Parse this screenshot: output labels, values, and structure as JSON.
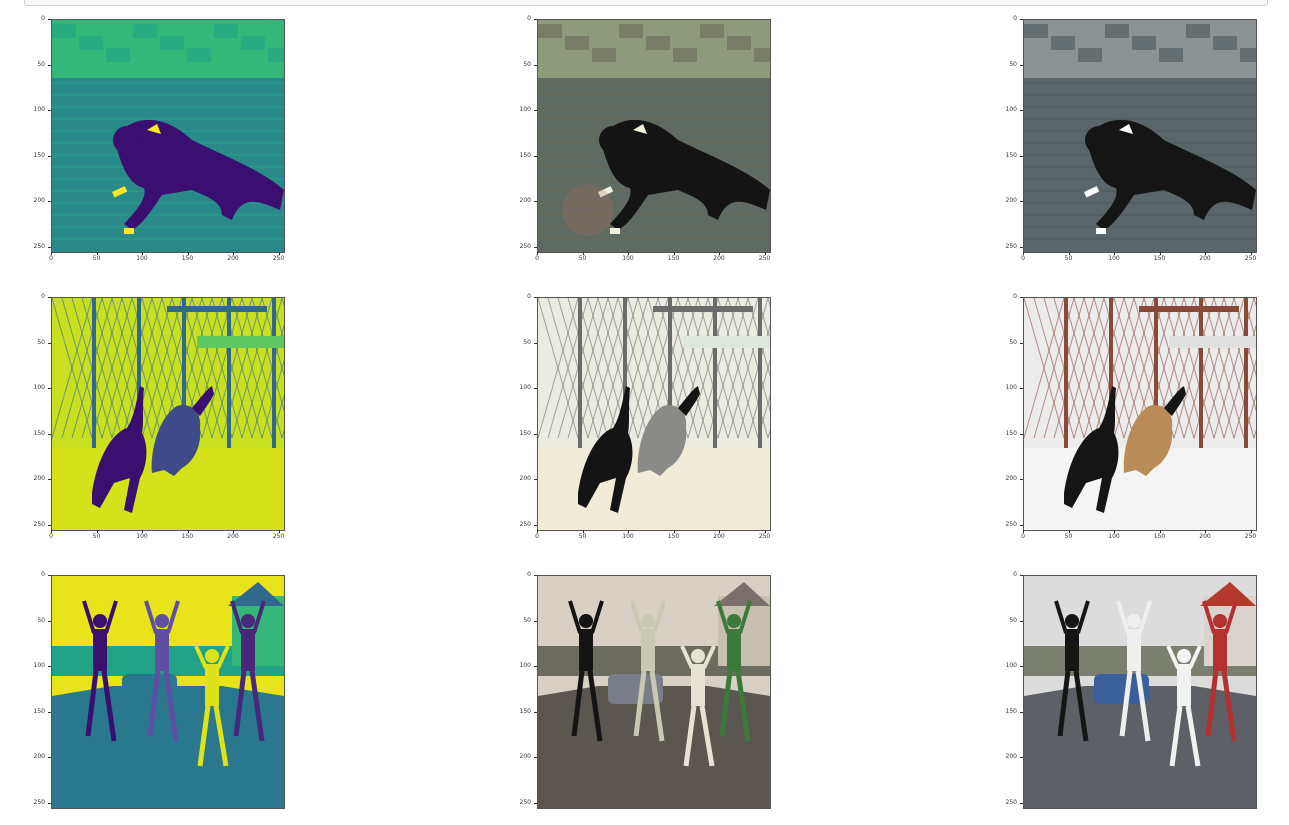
{
  "tick_labels": [
    "0",
    "50",
    "100",
    "150",
    "200",
    "250"
  ],
  "panels": [
    {
      "scene": "dog-water",
      "mode": "viridis"
    },
    {
      "scene": "dog-water",
      "mode": "noisy"
    },
    {
      "scene": "dog-water",
      "mode": "color"
    },
    {
      "scene": "dogs-snow",
      "mode": "viridis"
    },
    {
      "scene": "dogs-snow",
      "mode": "noisy"
    },
    {
      "scene": "dogs-snow",
      "mode": "color"
    },
    {
      "scene": "kids-jumping",
      "mode": "viridis"
    },
    {
      "scene": "kids-jumping",
      "mode": "noisy"
    },
    {
      "scene": "kids-jumping",
      "mode": "color"
    }
  ],
  "colors": {
    "viridis_dark": "#440154",
    "viridis_mid": "#21918c",
    "viridis_light": "#fde725"
  }
}
